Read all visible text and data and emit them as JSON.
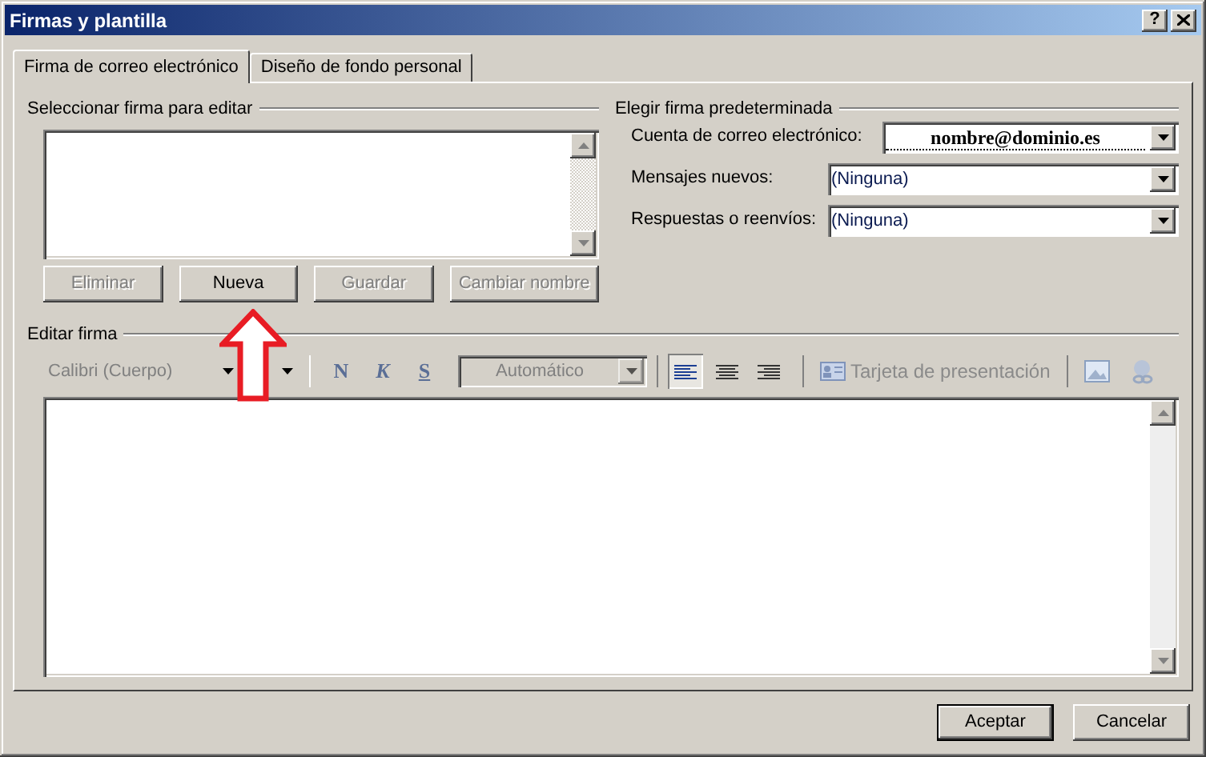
{
  "window": {
    "title": "Firmas y plantilla",
    "help": "?"
  },
  "tabs": [
    {
      "label": "Firma de correo electrónico",
      "selected": true
    },
    {
      "label": "Diseño de fondo personal",
      "selected": false
    }
  ],
  "select_signature": {
    "title": "Seleccionar firma para editar",
    "buttons": [
      {
        "label": "Eliminar",
        "disabled": true
      },
      {
        "label": "Nueva",
        "disabled": false
      },
      {
        "label": "Guardar",
        "disabled": true
      },
      {
        "label": "Cambiar nombre",
        "disabled": true
      }
    ]
  },
  "default_signature": {
    "title": "Elegir firma predeterminada",
    "rows": [
      {
        "label": "Cuenta de correo electrónico:",
        "value": "nombre@dominio.es",
        "focused": true
      },
      {
        "label": "Mensajes nuevos:",
        "value": "(Ninguna)",
        "focused": false
      },
      {
        "label": "Respuestas o reenvíos:",
        "value": "(Ninguna)",
        "focused": false
      }
    ]
  },
  "edit_signature": {
    "title": "Editar firma",
    "font": {
      "value": "Calibri (Cuerpo)",
      "disabled": true
    },
    "format_buttons": [
      {
        "label": "N",
        "kind": "bold"
      },
      {
        "label": "K",
        "kind": "italic"
      },
      {
        "label": "S",
        "kind": "underline"
      }
    ],
    "color": {
      "value": "Automático",
      "disabled": true
    },
    "alignments": [
      {
        "kind": "left",
        "selected": true
      },
      {
        "kind": "center",
        "selected": false
      },
      {
        "kind": "right",
        "selected": false
      }
    ],
    "business_card": {
      "label": "Tarjeta de presentación",
      "disabled": true
    }
  },
  "footer_buttons": [
    {
      "label": "Aceptar",
      "default": true
    },
    {
      "label": "Cancelar",
      "default": false
    }
  ]
}
